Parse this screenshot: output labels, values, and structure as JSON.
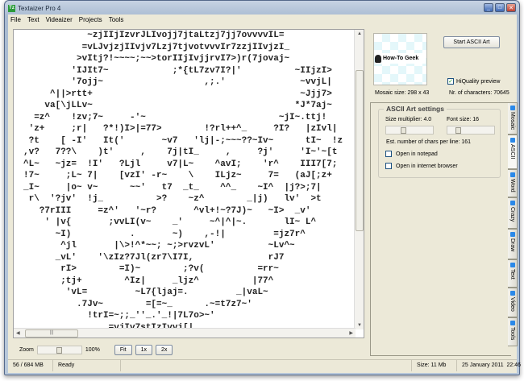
{
  "window": {
    "title": "Textaizer Pro 4",
    "icon_text": "Tz"
  },
  "menu": [
    "File",
    "Text",
    "Videaizer",
    "Projects",
    "Tools"
  ],
  "ascii_art": [
    "            ~zjIIjIzvrJLIvojj7jtaLtzj7jj7ovvvvIL=",
    "           =vLJvjzjIIvjv7Lzj7tjvotvvvIr7zzjIIvjzI_",
    "          >vItj?!~~~~;~~>torIIjIvjjrvI7>)r(7jovaj~",
    "         'IJIt7~            ;*{tL7zv7I?|'          ~IIjzI>",
    "         '7ojj~                   ,;.'              ~vvjL|",
    "     ^||>rtt+                                       ~Jjj7>",
    "    va[\\jLLv~                                      *J*7aj~",
    "  =z^    !zv;7~     -'~                         ~jI~.ttj!",
    " 'z+     ;r|   ?*!)I>|=77>        !?rl++^_     ?I?   |zIvl|",
    " ?t    [ -I'   It('       ~v7   'lj|-;~~~??~Iv~      tI~  !z",
    ",v?   7??\\    )t'     ,    7j|tI_     ,     ?j'     'I~'~[t",
    "^L~   ~jz=  !I'   ?Ljl     v7|L~    ^avI;    'r^    III7[7;",
    "!7~     ;L~ 7|    [vzI' -r~    \\    ILjz~     7=   (aJ[;z+",
    "_I~     |o~ v~      ~~'   t7  _t_    ^^_    ~I^  |j?>;7|",
    " r\\  '?jv'  !j_          >?    ~z^        _|j)   lv'  >t",
    "   ?7rIII     =z^'   '~r?       ^vl+!~?7J)~   ~I>  _v'",
    "    ' |v{       ;vvLI(v~    _'     ~^|^|~.       lI~ L^",
    "      ~I)           .       ~)    ,-!|         =jz7r^",
    "       ^jl       |\\>!^*~~; ~;>rvzvL'          ~Lv^~",
    "      _vL'    '\\zIz?7Jl(zr7\\I7I,              rJ7",
    "       rI>        =I)~        ;?v(          =rr~",
    "       ;tj+        ^Iz|     _ljz^          |77^",
    "        'vL=         ~L7{ljaj=.         _|vaL~",
    "          .7Jv~        =[=~_      .~=t7z7~'",
    "            !trI=~;;_''_.'_!|7L7o>~'",
    "                =vjIv7stIzIvvj[|"
  ],
  "zoom": {
    "label": "Zoom",
    "value": "100%",
    "level": 0.5,
    "buttons": [
      "Fit",
      "1x",
      "2x"
    ]
  },
  "status": {
    "memory": "56 / 684 MB",
    "state": "Ready",
    "size": "Size: 11 Mb",
    "date": "25 January 2011",
    "time": "22:46"
  },
  "right": {
    "preview_logo": "How-To Geek",
    "start_button": "Start ASCII Art",
    "hiquality": {
      "label": "HiQuality preview",
      "checked": true
    },
    "mosaic_size": "Mosaic size: 298 x 43",
    "nr_chars": "Nr. of characters: 70645"
  },
  "settings": {
    "title": "ASCII Art settings",
    "size_multiplier": "Size multiplier: 4.0",
    "font_size": "Font size: 16",
    "est_chars": "Est. number of chars per line: 161",
    "open_notepad": "Open in notepad",
    "open_browser": "Open in internet browser"
  },
  "tabs": [
    "Mosaic",
    "ASCII",
    "Word",
    "Crazy",
    "Draw",
    "Text",
    "Video",
    "Tools"
  ],
  "colors": {
    "tab_icon": "#2a88e8",
    "window_frame": "#a9bbd2",
    "panel": "#ece9d8"
  }
}
